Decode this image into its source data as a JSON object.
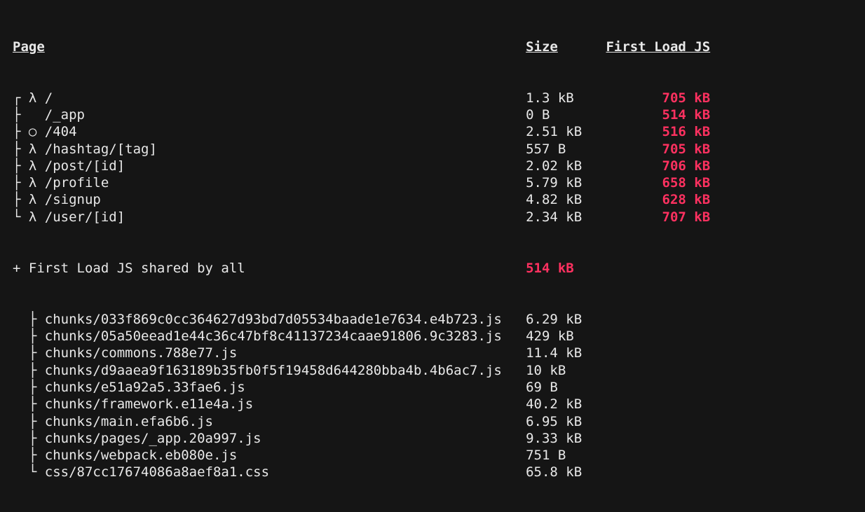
{
  "headers": {
    "page": "Page",
    "size": "Size",
    "first_load": "First Load JS"
  },
  "routes": [
    {
      "tree": "┌ λ ",
      "path": "/",
      "size": "1.3 kB",
      "first_load": "705 kB",
      "fl_red": true
    },
    {
      "tree": "├   ",
      "path": "/_app",
      "size": "0 B",
      "first_load": "514 kB",
      "fl_red": true
    },
    {
      "tree": "├ ○ ",
      "path": "/404",
      "size": "2.51 kB",
      "first_load": "516 kB",
      "fl_red": true
    },
    {
      "tree": "├ λ ",
      "path": "/hashtag/[tag]",
      "size": "557 B",
      "first_load": "705 kB",
      "fl_red": true
    },
    {
      "tree": "├ λ ",
      "path": "/post/[id]",
      "size": "2.02 kB",
      "first_load": "706 kB",
      "fl_red": true
    },
    {
      "tree": "├ λ ",
      "path": "/profile",
      "size": "5.79 kB",
      "first_load": "658 kB",
      "fl_red": true
    },
    {
      "tree": "├ λ ",
      "path": "/signup",
      "size": "4.82 kB",
      "first_load": "628 kB",
      "fl_red": true
    },
    {
      "tree": "└ λ ",
      "path": "/user/[id]",
      "size": "2.34 kB",
      "first_load": "707 kB",
      "fl_red": true
    }
  ],
  "shared_header": {
    "prefix": "+ ",
    "label": "First Load JS shared by all",
    "size": "514 kB",
    "size_red": true
  },
  "chunks": [
    {
      "tree": "  ├ ",
      "file": "chunks/033f869c0cc364627d93bd7d05534baade1e7634.e4b723.js",
      "size": "6.29 kB"
    },
    {
      "tree": "  ├ ",
      "file": "chunks/05a50eead1e44c36c47bf8c41137234caae91806.9c3283.js",
      "size": "429 kB"
    },
    {
      "tree": "  ├ ",
      "file": "chunks/commons.788e77.js",
      "size": "11.4 kB"
    },
    {
      "tree": "  ├ ",
      "file": "chunks/d9aaea9f163189b35fb0f5f19458d644280bba4b.4b6ac7.js",
      "size": "10 kB"
    },
    {
      "tree": "  ├ ",
      "file": "chunks/e51a92a5.33fae6.js",
      "size": "69 B"
    },
    {
      "tree": "  ├ ",
      "file": "chunks/framework.e11e4a.js",
      "size": "40.2 kB"
    },
    {
      "tree": "  ├ ",
      "file": "chunks/main.efa6b6.js",
      "size": "6.95 kB"
    },
    {
      "tree": "  ├ ",
      "file": "chunks/pages/_app.20a997.js",
      "size": "9.33 kB"
    },
    {
      "tree": "  ├ ",
      "file": "chunks/webpack.eb080e.js",
      "size": "751 B"
    },
    {
      "tree": "  └ ",
      "file": "css/87cc17674086a8aef8a1.css",
      "size": "65.8 kB"
    }
  ]
}
